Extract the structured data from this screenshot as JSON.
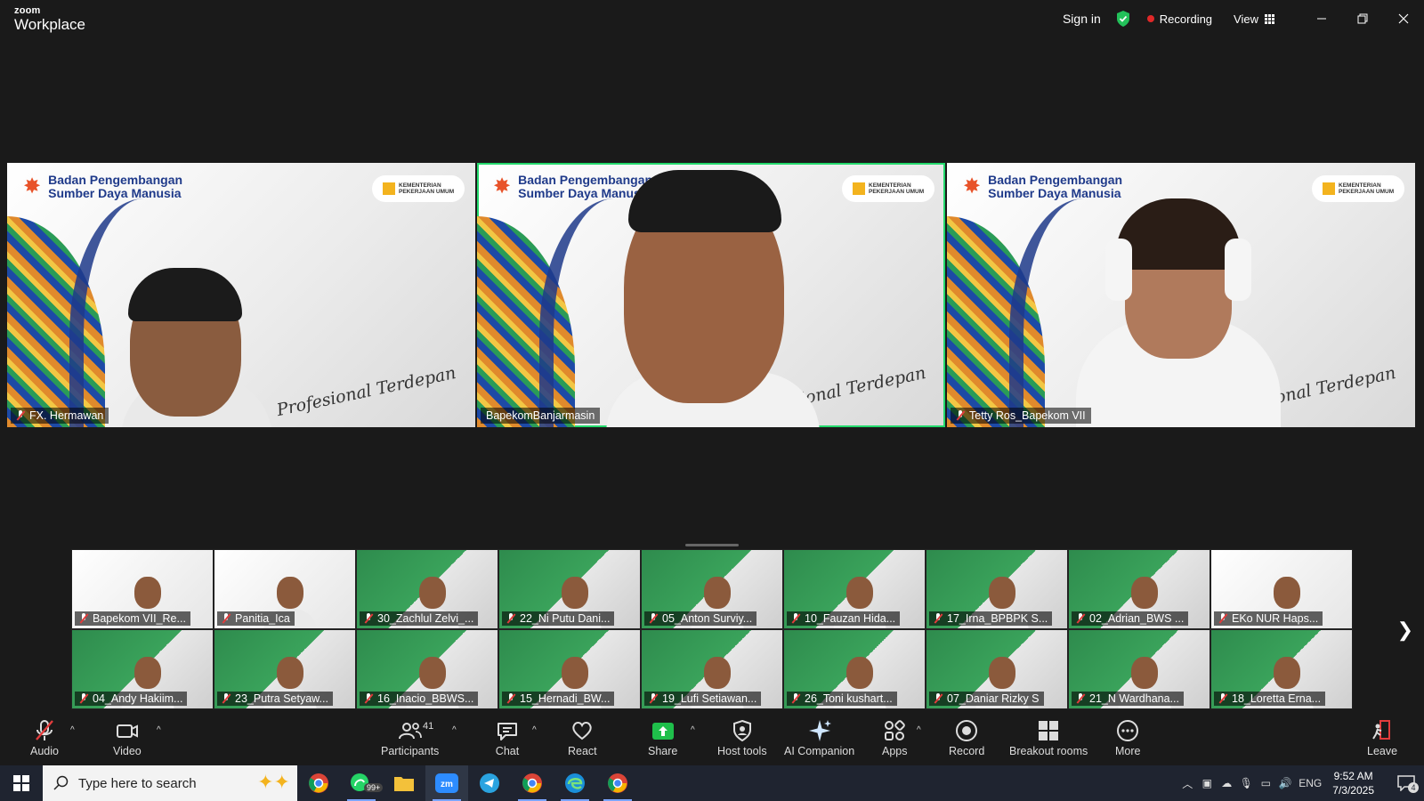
{
  "titlebar": {
    "brand_line1": "zoom",
    "brand_line2": "Workplace",
    "sign_in": "Sign in",
    "recording": "Recording",
    "view": "View"
  },
  "tiles": [
    {
      "name": "FX. Hermawan",
      "header": "Badan Pengembangan\nSumber Daya Manusia",
      "org": "KEMENTERIAN PEKERJAAN UMUM",
      "slogan": "Profesional Terdepan",
      "active": false
    },
    {
      "name": "BapekomBanjarmasin",
      "header": "Badan Pengembangan\nSumber Daya Manusia",
      "org": "KEMENTERIAN PEKERJAAN UMUM",
      "slogan": "Profesional Terdepan",
      "active": true
    },
    {
      "name": "Tetty Ros_Bapekom VII",
      "header": "Badan Pengembangan\nSumber Daya Manusia",
      "org": "KEMENTERIAN PEKERJAAN UMUM",
      "slogan": "Profesional Terdepan",
      "active": false
    }
  ],
  "gallery": [
    {
      "name": "Bapekom VII_Re...",
      "bg": "white"
    },
    {
      "name": "Panitia_Ica",
      "bg": "white"
    },
    {
      "name": "30_Zachlul Zelvi_...",
      "bg": "green"
    },
    {
      "name": "22_Ni Putu Dani...",
      "bg": "green"
    },
    {
      "name": "05_Anton Surviy...",
      "bg": "green"
    },
    {
      "name": "10_Fauzan Hida...",
      "bg": "green"
    },
    {
      "name": "17_Irna_BPBPK S...",
      "bg": "green"
    },
    {
      "name": "02_Adrian_BWS ...",
      "bg": "green"
    },
    {
      "name": "EKo NUR Haps...",
      "bg": "white"
    },
    {
      "name": "04_Andy Hakiim...",
      "bg": "green"
    },
    {
      "name": "23_Putra Setyaw...",
      "bg": "green"
    },
    {
      "name": "16_Inacio_BBWS...",
      "bg": "green"
    },
    {
      "name": "15_Hernadi_BW...",
      "bg": "green"
    },
    {
      "name": "19_Lufi Setiawan...",
      "bg": "green"
    },
    {
      "name": "26_Toni kushart...",
      "bg": "green"
    },
    {
      "name": "07_Daniar Rizky S",
      "bg": "green"
    },
    {
      "name": "21_N Wardhana...",
      "bg": "green"
    },
    {
      "name": "18_Loretta Erna...",
      "bg": "green"
    }
  ],
  "controls": {
    "audio": "Audio",
    "video": "Video",
    "participants": "Participants",
    "participants_count": "41",
    "chat": "Chat",
    "react": "React",
    "share": "Share",
    "host_tools": "Host tools",
    "ai_companion": "AI Companion",
    "apps": "Apps",
    "record": "Record",
    "breakout_rooms": "Breakout rooms",
    "more": "More",
    "leave": "Leave"
  },
  "taskbar": {
    "search_placeholder": "Type here to search",
    "whatsapp_badge": "99+",
    "lang": "ENG",
    "time": "9:52 AM",
    "date": "7/3/2025",
    "notif_count": "4"
  },
  "colors": {
    "active_speaker": "#23d96c",
    "recording_dot": "#e02828",
    "share_green": "#1fbf4b",
    "leave_red": "#e23c3c"
  }
}
